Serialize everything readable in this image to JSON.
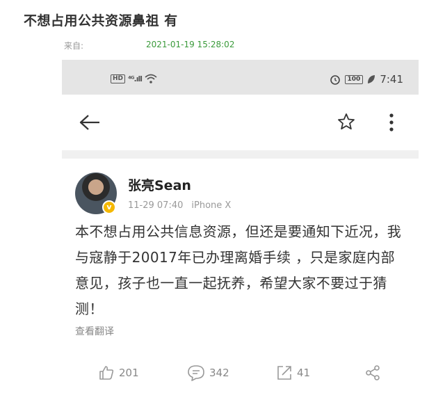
{
  "post": {
    "title": "不想占用公共资源鼻祖 有",
    "source_label": "来自:",
    "timestamp": "2021-01-19 15:28:02"
  },
  "status_bar": {
    "hd": "HD",
    "signal": "⁴ᴳ.ıll",
    "battery": "100",
    "time": "7:41"
  },
  "weibo": {
    "username": "张亮Sean",
    "date": "11-29 07:40",
    "device": "iPhone X",
    "content": "本不想占用公共信息资源，但还是要通知下近况，我与寇静于20017年已办理离婚手续 ，只是家庭内部意见，孩子也一直一起抚养，希望大家不要过于猜测！",
    "translate_label": "查看翻译",
    "likes": "201",
    "comments": "342",
    "reposts": "41"
  },
  "icons": {
    "back": "arrow-left-icon",
    "favorite": "star-icon",
    "more": "more-vertical-icon",
    "like": "thumbs-up-icon",
    "comment": "comment-icon",
    "repost": "share-out-icon",
    "share": "share-nodes-icon",
    "alarm": "alarm-icon",
    "wifi": "wifi-icon",
    "leaf": "leaf-icon"
  },
  "colors": {
    "timestamp": "#3a9a3a",
    "verified_badge": "#f5b800",
    "status_bar_bg": "#e5e5e5"
  }
}
